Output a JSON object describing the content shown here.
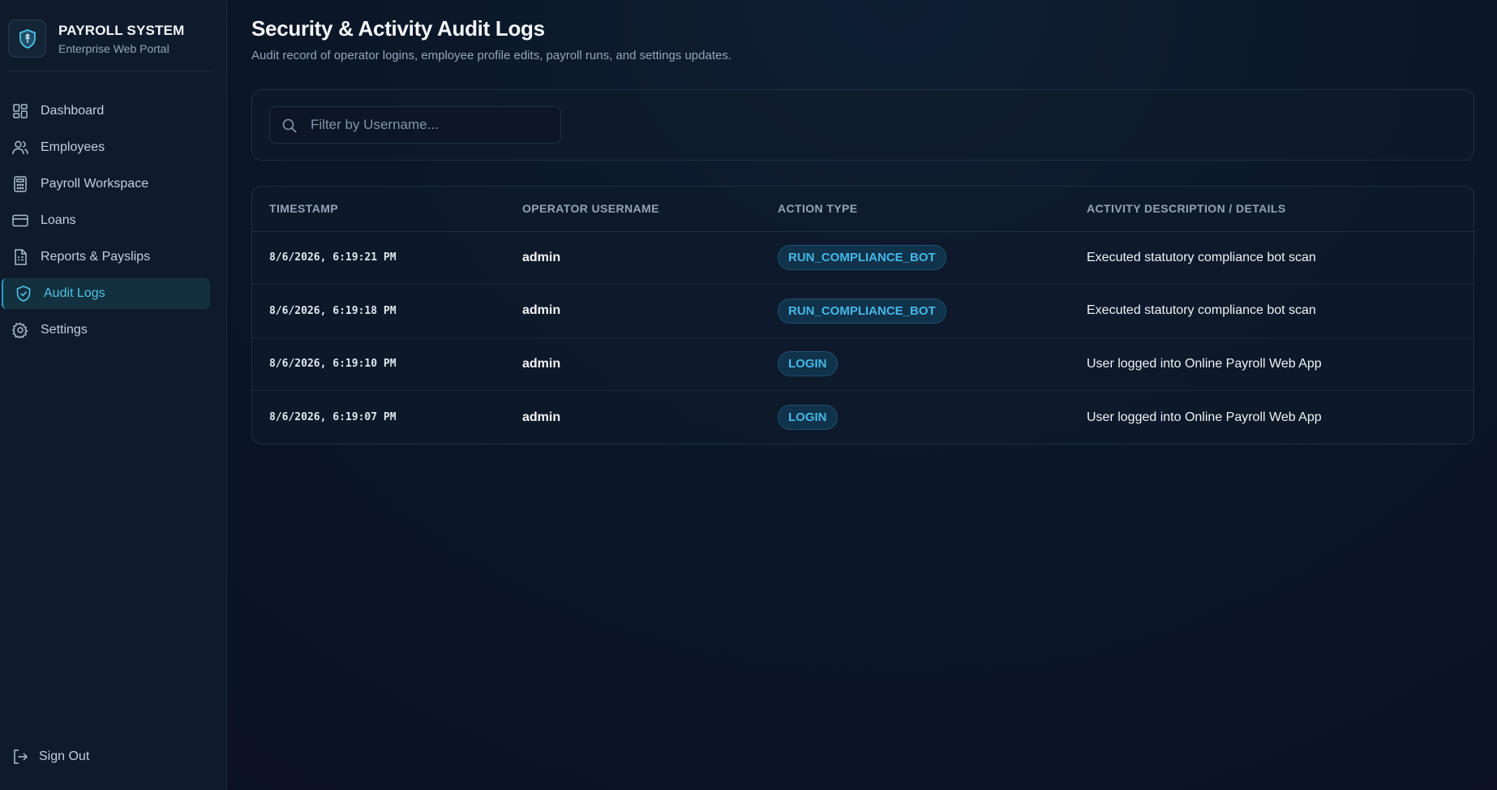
{
  "brand": {
    "title": "PAYROLL SYSTEM",
    "subtitle": "Enterprise Web Portal",
    "icon": "shield-icon"
  },
  "sidebar": {
    "items": [
      {
        "label": "Dashboard",
        "icon": "dashboard-grid-icon"
      },
      {
        "label": "Employees",
        "icon": "users-icon"
      },
      {
        "label": "Payroll Workspace",
        "icon": "calculator-icon"
      },
      {
        "label": "Loans",
        "icon": "credit-card-icon"
      },
      {
        "label": "Reports & Payslips",
        "icon": "report-document-icon"
      },
      {
        "label": "Audit Logs",
        "icon": "shield-check-icon",
        "active": true
      },
      {
        "label": "Settings",
        "icon": "gear-icon"
      }
    ],
    "signout_label": "Sign Out"
  },
  "header": {
    "title": "Security & Activity Audit Logs",
    "subtitle": "Audit record of operator logins, employee profile edits, payroll runs, and settings updates."
  },
  "filter": {
    "placeholder": "Filter by Username..."
  },
  "table": {
    "columns": [
      "TIMESTAMP",
      "OPERATOR USERNAME",
      "ACTION TYPE",
      "ACTIVITY DESCRIPTION / DETAILS"
    ],
    "rows": [
      {
        "timestamp": "8/6/2026, 6:19:21 PM",
        "user": "admin",
        "action": "RUN_COMPLIANCE_BOT",
        "details": "Executed statutory compliance bot scan"
      },
      {
        "timestamp": "8/6/2026, 6:19:18 PM",
        "user": "admin",
        "action": "RUN_COMPLIANCE_BOT",
        "details": "Executed statutory compliance bot scan"
      },
      {
        "timestamp": "8/6/2026, 6:19:10 PM",
        "user": "admin",
        "action": "LOGIN",
        "details": "User logged into Online Payroll Web App"
      },
      {
        "timestamp": "8/6/2026, 6:19:07 PM",
        "user": "admin",
        "action": "LOGIN",
        "details": "User logged into Online Payroll Web App"
      }
    ]
  },
  "colors": {
    "accent": "#46b7e6",
    "background": "#0b1627",
    "sidebar": "#0f1b2c"
  }
}
